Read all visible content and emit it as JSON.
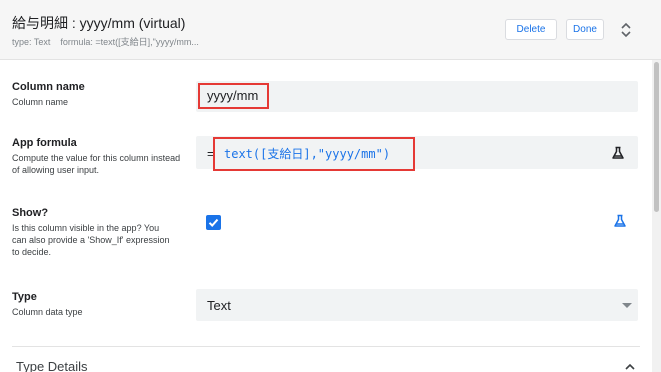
{
  "header": {
    "title": "給与明細 : yyyy/mm (virtual)",
    "type_text": "type: Text",
    "formula_text": "formula: =text([支給日],\"yyyy/mm...",
    "delete_label": "Delete",
    "done_label": "Done"
  },
  "column_name": {
    "label": "Column name",
    "desc": "Column name",
    "value": "yyyy/mm"
  },
  "app_formula": {
    "label": "App formula",
    "desc": "Compute the value for this column instead of allowing user input.",
    "eq": "=",
    "value": "text([支給日],\"yyyy/mm\")"
  },
  "show": {
    "label": "Show?",
    "desc": "Is this column visible in the app? You can also provide a 'Show_If' expression to decide.",
    "checked": true
  },
  "type": {
    "label": "Type",
    "desc": "Column data type",
    "value": "Text"
  },
  "type_details": {
    "label": "Type Details"
  },
  "colors": {
    "accent": "#1a73e8",
    "highlight": "#e53935"
  }
}
